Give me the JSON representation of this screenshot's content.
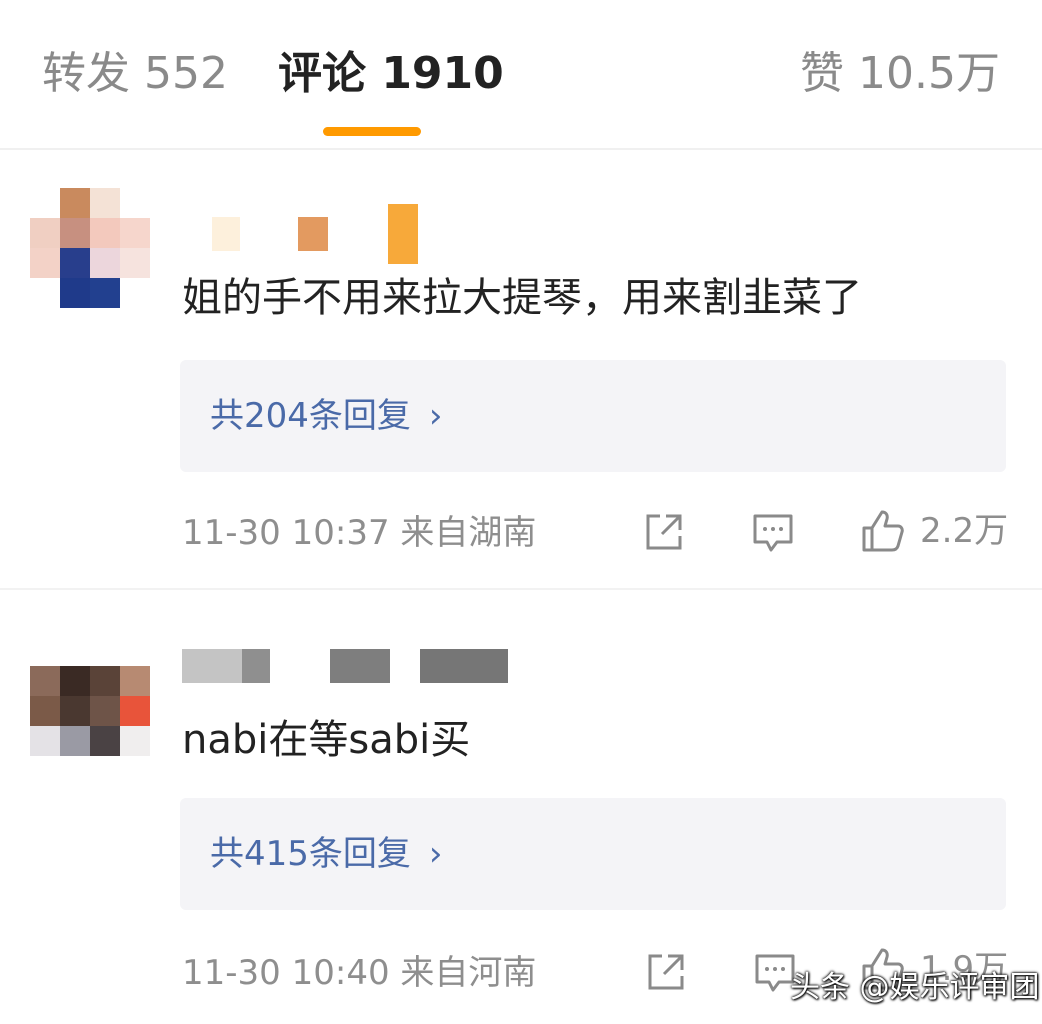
{
  "tabs": {
    "forward": "转发 552",
    "comments": "评论 1910",
    "likes": "赞 10.5万"
  },
  "comments": [
    {
      "text": "姐的手不用来拉大提琴，用来割韭菜了",
      "replies": "共204条回复",
      "time": "11-30 10:37 来自湖南",
      "likes": "2.2万"
    },
    {
      "text": "nabi在等sabi买",
      "replies": "共415条回复",
      "time": "11-30 10:40 来自河南",
      "likes": "1.9万"
    }
  ],
  "icons": {
    "share": "share-icon",
    "comment": "comment-icon",
    "like": "thumbs-up-icon",
    "chevron": "chevron-right-icon"
  },
  "watermark": "头条 @娱乐评审团",
  "colors": {
    "accent": "#ff9a00",
    "reply_link": "#4a6aa8",
    "meta": "#8e8e8e"
  }
}
